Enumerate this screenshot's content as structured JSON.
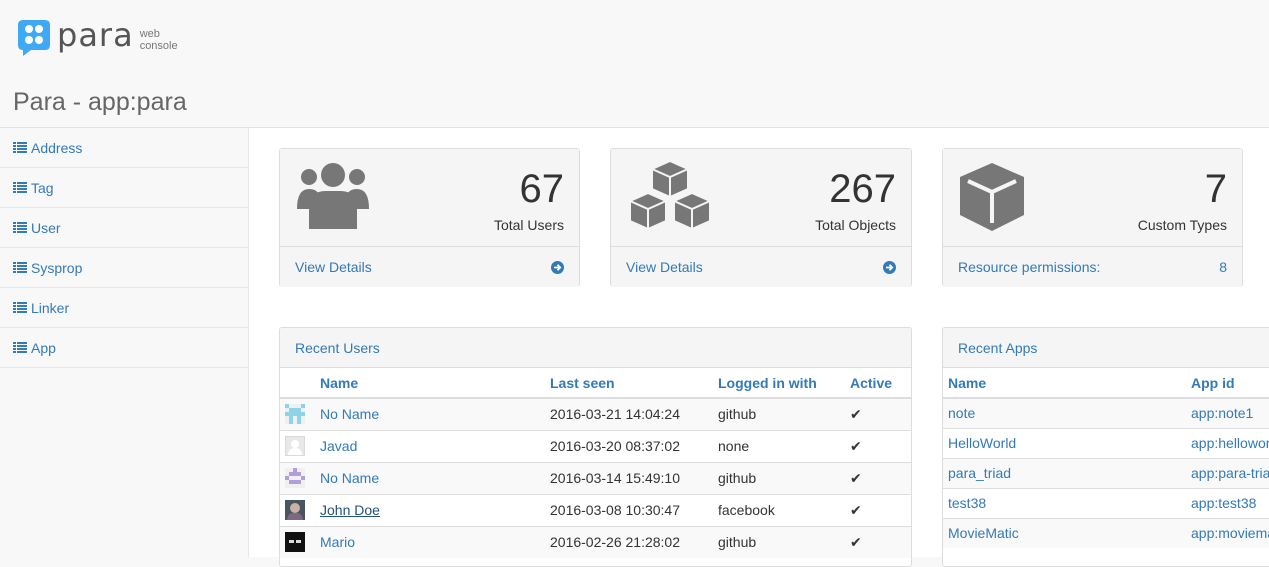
{
  "header": {
    "logo_word": "para",
    "logo_sub1": "web",
    "logo_sub2": "console",
    "page_title": "Para - app:para"
  },
  "sidebar": {
    "items": [
      {
        "label": "Address"
      },
      {
        "label": "Tag"
      },
      {
        "label": "User"
      },
      {
        "label": "Sysprop"
      },
      {
        "label": "Linker"
      },
      {
        "label": "App"
      }
    ]
  },
  "stats": [
    {
      "value": "67",
      "label": "Total Users",
      "footer": "View Details",
      "icon": "users-icon"
    },
    {
      "value": "267",
      "label": "Total Objects",
      "footer": "View Details",
      "icon": "cubes-icon"
    },
    {
      "value": "7",
      "label": "Custom Types",
      "footer": "Resource permissions:",
      "footer_value": "8",
      "icon": "cube-icon"
    }
  ],
  "recent_users": {
    "title": "Recent Users",
    "columns": [
      "Name",
      "Last seen",
      "Logged in with",
      "Active"
    ],
    "rows": [
      {
        "name": "No Name",
        "last_seen": "2016-03-21 14:04:24",
        "provider": "github",
        "active": "✔"
      },
      {
        "name": "Javad",
        "last_seen": "2016-03-20 08:37:02",
        "provider": "none",
        "active": "✔"
      },
      {
        "name": "No Name",
        "last_seen": "2016-03-14 15:49:10",
        "provider": "github",
        "active": "✔"
      },
      {
        "name": "John Doe",
        "last_seen": "2016-03-08 10:30:47",
        "provider": "facebook",
        "active": "✔"
      },
      {
        "name": "Mario",
        "last_seen": "2016-02-26 21:28:02",
        "provider": "github",
        "active": "✔"
      }
    ]
  },
  "recent_apps": {
    "title": "Recent Apps",
    "columns": [
      "Name",
      "App id"
    ],
    "rows": [
      {
        "name": "note",
        "app_id": "app:note1"
      },
      {
        "name": "HelloWorld",
        "app_id": "app:helloworld"
      },
      {
        "name": "para_triad",
        "app_id": "app:para-triad"
      },
      {
        "name": "test38",
        "app_id": "app:test38"
      },
      {
        "name": "MovieMatic",
        "app_id": "app:moviematic"
      }
    ]
  },
  "colors": {
    "link": "#337ab7",
    "panel_bg": "#f5f5f5",
    "logo_blue": "#3fa9f5"
  }
}
